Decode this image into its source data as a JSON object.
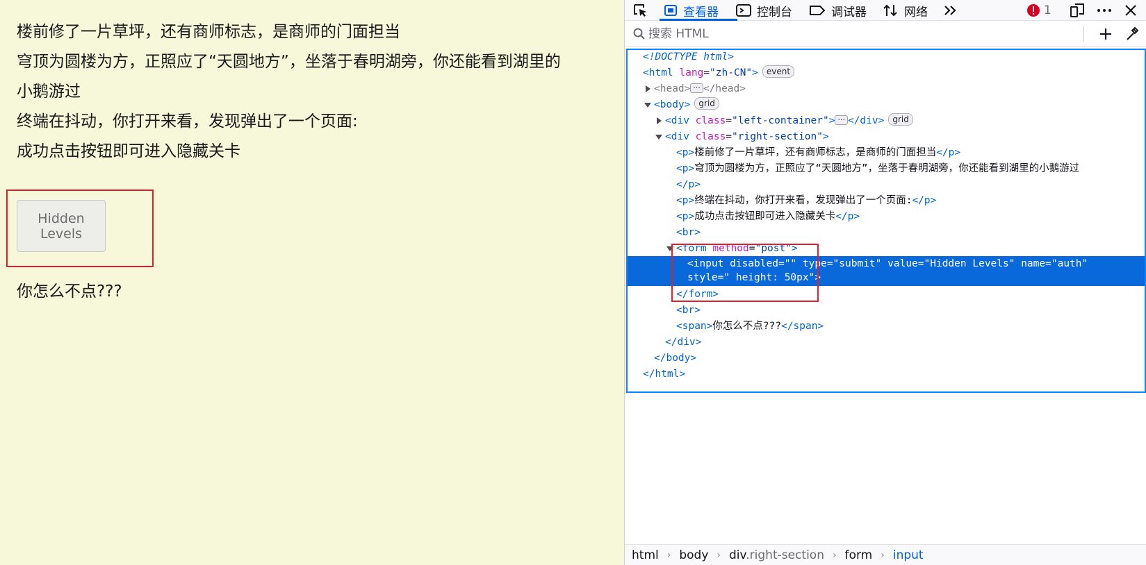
{
  "page": {
    "lines": [
      "楼前修了一片草坪，还有商师标志，是商师的门面担当",
      "穹顶为圆楼为方，正照应了“天圆地方”，坐落于春明湖旁，你还能看到湖里的",
      "小鹅游过",
      "终端在抖动，你打开来看，发现弹出了一个页面:",
      "成功点击按钮即可进入隐藏关卡"
    ],
    "button_label": "Hidden Levels",
    "tail_text": "你怎么不点???"
  },
  "devtools": {
    "tabs": [
      {
        "label": "查看器",
        "icon": "inspector-icon",
        "active": true
      },
      {
        "label": "控制台",
        "icon": "console-icon"
      },
      {
        "label": "调试器",
        "icon": "debugger-icon"
      },
      {
        "label": "网络",
        "icon": "network-icon"
      }
    ],
    "error_count": "1",
    "search_placeholder": "搜索 HTML",
    "markup": {
      "doctype": "<!DOCTYPE html>",
      "html_lang": "\"zh-CN\"",
      "event_badge": "event",
      "grid_badge": "grid",
      "left_container_class": "\"left-container\"",
      "right_section_class": "\"right-section\"",
      "p1": "楼前修了一片草坪，还有商师标志，是商师的门面担当",
      "p2": "穹顶为圆楼为方，正照应了“天圆地方”，坐落于春明湖旁，你还能看到湖里的小鹅游过",
      "p3": "终端在抖动，你打开来看，发现弹出了一个页面:",
      "p4": "成功点击按钮即可进入隐藏关卡",
      "form_method": "\"post\"",
      "input_disabled": "\"\"",
      "input_type": "\"submit\"",
      "input_value": "\"Hidden Levels\"",
      "input_name": "\"auth\"",
      "input_style": "\" height: 50px\"",
      "span_text": "你怎么不点???"
    },
    "breadcrumb": {
      "html": "html",
      "body": "body",
      "div_tag": "div",
      "div_class": ".right-section",
      "form": "form",
      "input": "input"
    }
  }
}
